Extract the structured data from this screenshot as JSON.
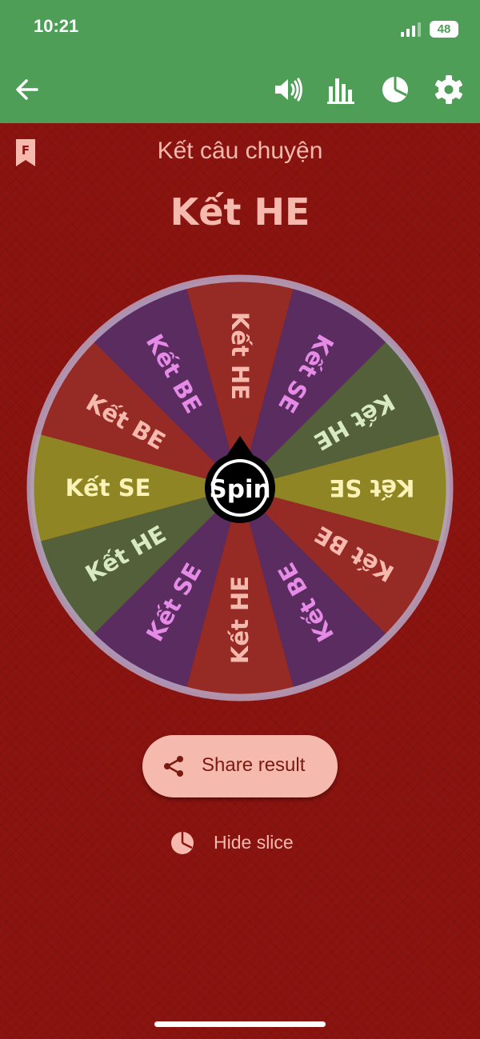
{
  "status_bar": {
    "time": "10:21",
    "battery": "48"
  },
  "app_bar": {
    "icons": [
      "back-arrow-icon",
      "sound-icon",
      "stats-bar-chart-icon",
      "pie-chart-icon",
      "settings-gear-icon"
    ]
  },
  "favorite_badge": "F",
  "wheel_title": "Kết câu chuyện",
  "result": "Kết HE",
  "wheel": {
    "spin_label": "Spin",
    "slices": [
      {
        "label": "Kết HE",
        "color": "#962a24",
        "text_color": "#f6b9ae"
      },
      {
        "label": "Kết SE",
        "color": "#5b2c5f",
        "text_color": "#e58ae6"
      },
      {
        "label": "Kết HE",
        "color": "#53603a",
        "text_color": "#d7eac1"
      },
      {
        "label": "Kết SE",
        "color": "#8f8524",
        "text_color": "#fbf2b8"
      },
      {
        "label": "Kết BE",
        "color": "#962a24",
        "text_color": "#f6b9ae"
      },
      {
        "label": "Kết BE",
        "color": "#5b2c5f",
        "text_color": "#e58ae6"
      },
      {
        "label": "Kết HE",
        "color": "#962a24",
        "text_color": "#f6b9ae"
      },
      {
        "label": "Kết SE",
        "color": "#5b2c5f",
        "text_color": "#e58ae6"
      },
      {
        "label": "Kết HE",
        "color": "#53603a",
        "text_color": "#d7eac1"
      },
      {
        "label": "Kết SE",
        "color": "#8f8524",
        "text_color": "#fbf2b8"
      },
      {
        "label": "Kết BE",
        "color": "#962a24",
        "text_color": "#f6b9ae"
      },
      {
        "label": "Kết BE",
        "color": "#5b2c5f",
        "text_color": "#e58ae6"
      }
    ],
    "rim_color": "#b8a6c4"
  },
  "share_button": {
    "label": "Share result"
  },
  "hide_slice": {
    "label": "Hide slice"
  },
  "colors": {
    "app_bar": "#4f9e58",
    "background": "#8c1410",
    "accent_text": "#f6b9ae"
  }
}
